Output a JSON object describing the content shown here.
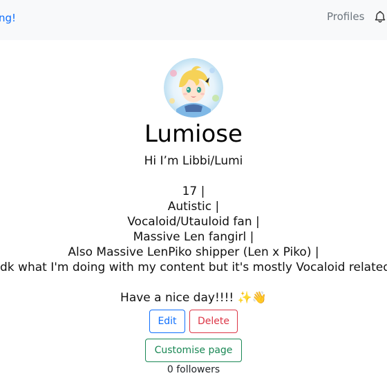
{
  "navbar": {
    "brand_text": "ng!",
    "profiles_link": "Profiles",
    "bell_icon": "bell-icon"
  },
  "profile": {
    "username": "Lumiose",
    "bio_lines": [
      "Hi I’m Libbi/Lumi",
      "",
      "17 |",
      "Autistic |",
      "Vocaloid/Utauloid fan |",
      "Massive Len fangirl |",
      "Also Massive LenPiko shipper (Len x Piko) |",
      "Idk what I'm doing with my content but it's mostly Vocaloid related",
      "",
      "Have a nice day!!!! ✨👋"
    ],
    "edit_label": "Edit",
    "delete_label": "Delete",
    "customise_label": "Customise page",
    "followers_text": "0 followers"
  },
  "colors": {
    "primary": "#0d6efd",
    "danger": "#dc3545",
    "success": "#198754",
    "muted": "#6c757d",
    "navbar_bg": "#f8f9fa"
  }
}
